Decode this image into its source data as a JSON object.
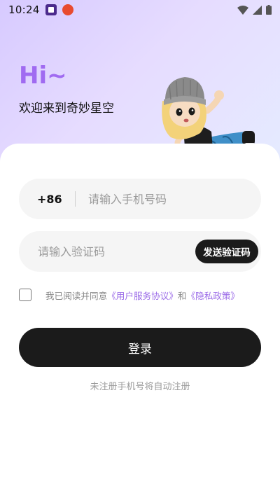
{
  "status_bar": {
    "time": "10:24",
    "icons": [
      "app-notification-icon-1",
      "app-notification-icon-2",
      "wifi-icon",
      "signal-icon",
      "battery-icon"
    ]
  },
  "greeting": {
    "hi": "Hi~",
    "welcome": "欢迎来到奇妙星空"
  },
  "phone": {
    "country_code": "+86",
    "placeholder": "请输入手机号码",
    "value": ""
  },
  "verification": {
    "placeholder": "请输入验证码",
    "value": "",
    "send_label": "发送验证码"
  },
  "agreement": {
    "checked": false,
    "prefix": "我已阅读并同意",
    "user_agreement": "《用户服务协议》",
    "conjunction": "和",
    "privacy_policy": "《隐私政策》"
  },
  "login": {
    "label": "登录"
  },
  "footer": {
    "auto_register": "未注册手机号将自动注册"
  },
  "colors": {
    "accent_purple": "#a06bf1",
    "link_purple": "#9b6be8",
    "button_dark": "#1b1b1b",
    "field_bg": "#f5f5f5"
  }
}
